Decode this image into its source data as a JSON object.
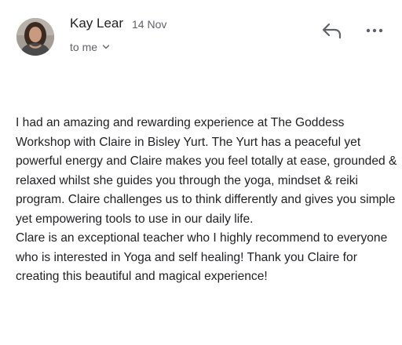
{
  "header": {
    "sender_name": "Kay Lear",
    "date": "14 Nov",
    "recipient": "to me",
    "icons": {
      "avatar": "sender-avatar-photo",
      "reply": "reply-arrow-icon",
      "more": "more-options-icon",
      "chevron": "chevron-down-icon"
    }
  },
  "body": {
    "paragraph_1": "I had an amazing and rewarding experience at The Goddess Workshop with Claire in Bisley Yurt. The Yurt has a peaceful yet powerful energy and Claire makes you feel totally at ease, grounded & relaxed whilst she guides you through the yoga, mindset & reiki program. Claire challenges us to think differently and gives you simple yet empowering tools to use in our daily life.",
    "paragraph_2": "Clare is an exceptional teacher who I highly recommend to everyone who is interested in Yoga and self healing! Thank you Claire for creating this beautiful and magical experience!"
  },
  "colors": {
    "primary_text": "#202124",
    "secondary_text": "#5f6368",
    "icon": "#5f6368"
  }
}
